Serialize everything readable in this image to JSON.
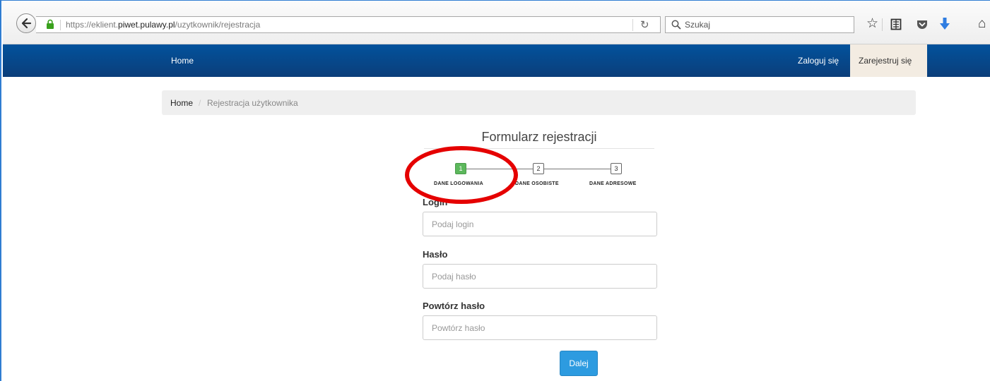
{
  "browser": {
    "url_prefix": "https://eklient.",
    "url_host": "piwet.pulawy.pl",
    "url_path": "/uzytkownik/rejestracja",
    "search_placeholder": "Szukaj",
    "icons": [
      "back-arrow-icon",
      "lock-icon",
      "reload-icon",
      "search-icon",
      "star-icon",
      "reading-list-icon",
      "pocket-icon",
      "download-icon",
      "home-icon"
    ]
  },
  "nav": {
    "home": "Home",
    "login": "Zaloguj się",
    "register": "Zarejestruj się"
  },
  "breadcrumb": {
    "home": "Home",
    "separator": "/",
    "current": "Rejestracja użytkownika"
  },
  "form": {
    "title": "Formularz rejestracji",
    "steps": [
      {
        "number": "1",
        "label": "DANE LOGOWANIA",
        "active": true
      },
      {
        "number": "2",
        "label": "DANE OSOBISTE",
        "active": false
      },
      {
        "number": "3",
        "label": "DANE ADRESOWE",
        "active": false
      }
    ],
    "fields": [
      {
        "label": "Login",
        "placeholder": "Podaj login",
        "value": ""
      },
      {
        "label": "Hasło",
        "placeholder": "Podaj hasło",
        "value": ""
      },
      {
        "label": "Powtórz hasło",
        "placeholder": "Powtórz hasło",
        "value": ""
      }
    ],
    "next_button": "Dalej"
  },
  "colors": {
    "navbar": "#0b4a8c",
    "active_step": "#5cb85c",
    "primary_button": "#2d9be0",
    "annotation": "#e50000"
  }
}
